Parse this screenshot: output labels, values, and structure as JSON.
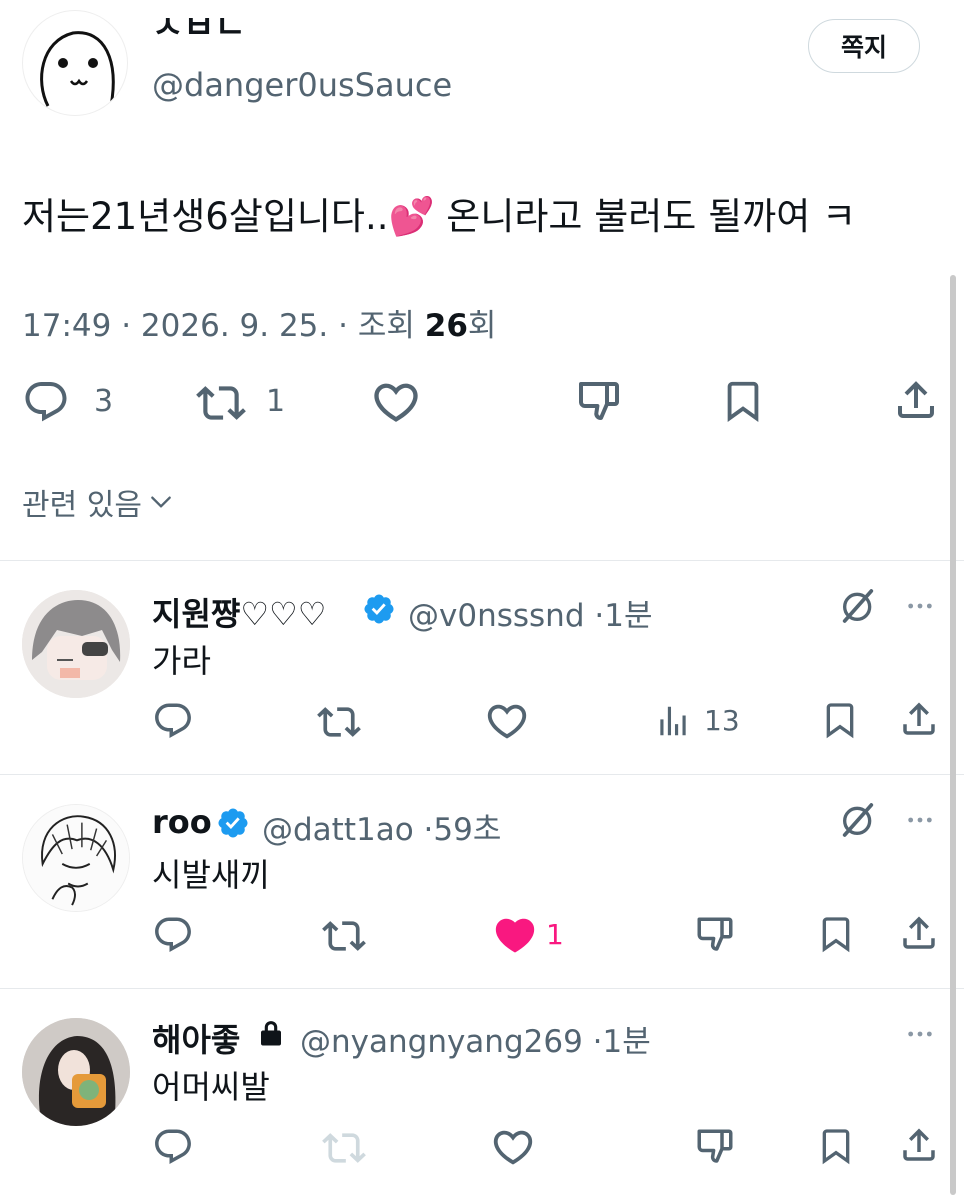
{
  "author": {
    "name_partial": "ㅅㅂㄴ",
    "handle": "@danger0usSauce",
    "dm_label": "쪽지"
  },
  "post": {
    "text_before": "저는21년생6살입니다..",
    "emoji": "💕",
    "text_after": " 온니라고 불러도 될까여 ㅋ",
    "time": "17:49",
    "date": "2026. 9. 25.",
    "views_label": "조회",
    "views_count": "26",
    "views_suffix": "회",
    "sep": "·",
    "actions": {
      "reply_count": "3",
      "retweet_count": "1"
    }
  },
  "sort_label": "관련 있음",
  "replies": [
    {
      "name": "지원쨩♡♡♡",
      "verified": true,
      "handle": "@v0nsssnd",
      "time": "1분",
      "text": "가라",
      "views": "13",
      "like_count": "",
      "liked": false
    },
    {
      "name": "roo",
      "verified": true,
      "handle": "@datt1ao",
      "time": "59초",
      "text": "시발새끼",
      "like_count": "1",
      "liked": true
    },
    {
      "name": "해아좋",
      "locked": true,
      "handle": "@nyangnyang269",
      "time": "1분",
      "text": "어머씨발"
    }
  ],
  "colors": {
    "text": "#0f1419",
    "secondary": "#536471",
    "verified": "#1d9bf0",
    "like": "#f91880",
    "divider": "#e6e9ec"
  },
  "icons": [
    "reply-icon",
    "retweet-icon",
    "like-icon",
    "dislike-icon",
    "bookmark-icon",
    "share-icon",
    "views-icon",
    "grok-icon",
    "more-icon",
    "verified-icon",
    "lock-icon",
    "chevron-down-icon"
  ]
}
